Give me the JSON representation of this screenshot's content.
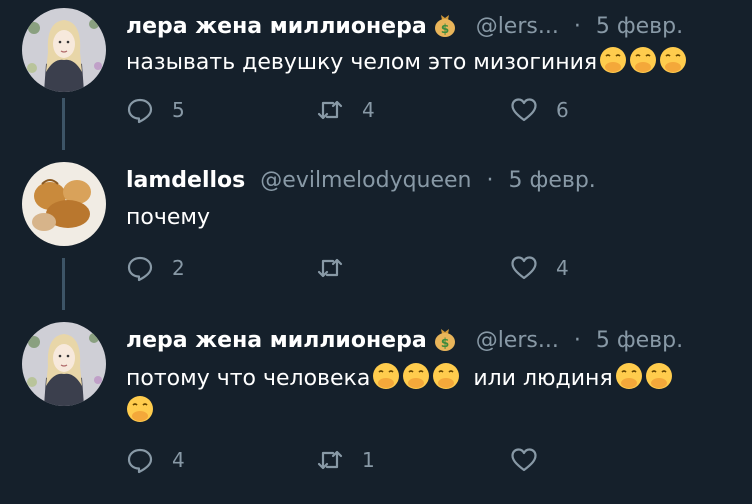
{
  "colors": {
    "background": "#15202b",
    "secondary_text": "#8899a6",
    "thread_line": "#3d5466"
  },
  "tweets": [
    {
      "name": "лера жена миллионера",
      "name_emoji": "money-bag-icon",
      "handle": "@lers...",
      "dot": "·",
      "date": "5 февр.",
      "text": "называть девушку челом это мизогиния",
      "reply_count": "5",
      "retweet_count": "4",
      "like_count": "6"
    },
    {
      "name": "lamdellos",
      "handle": "@evilmelodyqueen",
      "dot": "·",
      "date": "5 февр.",
      "text": "почему",
      "reply_count": "2",
      "retweet_count": "",
      "like_count": "4"
    },
    {
      "name": "лера жена миллионера",
      "name_emoji": "money-bag-icon",
      "handle": "@lers...",
      "dot": "·",
      "date": "5 февр.",
      "text_part1": "потому что человека",
      "text_part2": " или людиня",
      "reply_count": "4",
      "retweet_count": "1",
      "like_count": ""
    }
  ]
}
